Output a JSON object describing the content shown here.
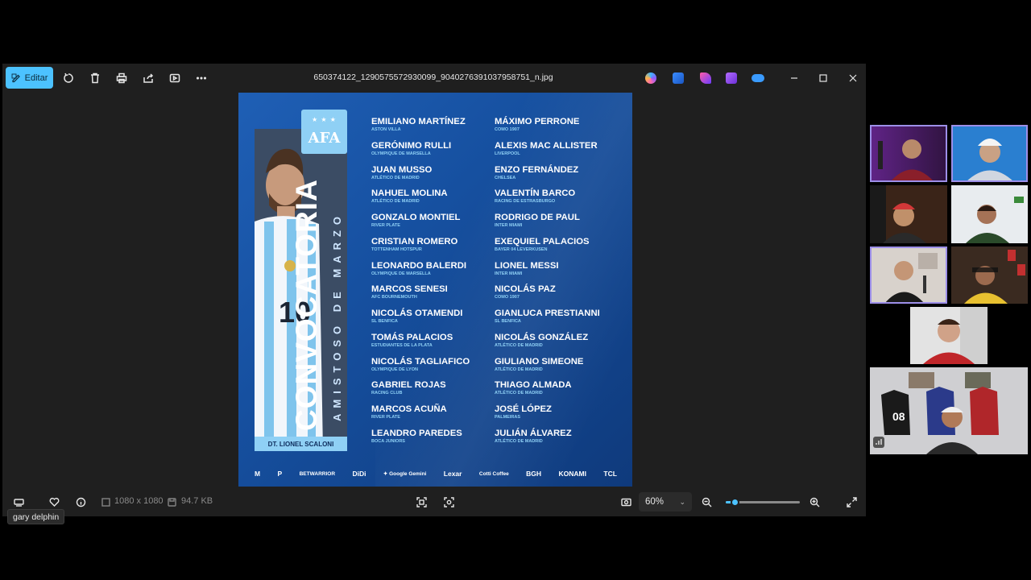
{
  "toolbar": {
    "edit_label": "Editar",
    "icons": [
      "edit-icon",
      "rotate-icon",
      "delete-icon",
      "print-icon",
      "share-icon",
      "slideshow-icon",
      "more-icon"
    ],
    "filename": "650374122_1290575572930099_9040276391037958751_n.jpg"
  },
  "poster": {
    "afa_label": "AFA",
    "afa_stars": "★ ★ ★",
    "title": "CONVOCATORIA",
    "subtitle": "AMISTOSO DE MARZO",
    "coach": "DT. LIONEL SCALONI",
    "players_left": [
      {
        "name": "EMILIANO MARTÍNEZ",
        "club": "ASTON VILLA"
      },
      {
        "name": "GERÓNIMO RULLI",
        "club": "OLYMPIQUE DE MARSELLA"
      },
      {
        "name": "JUAN MUSSO",
        "club": "ATLÉTICO DE MADRID"
      },
      {
        "name": "NAHUEL MOLINA",
        "club": "ATLÉTICO DE MADRID"
      },
      {
        "name": "GONZALO MONTIEL",
        "club": "RIVER PLATE"
      },
      {
        "name": "CRISTIAN ROMERO",
        "club": "TOTTENHAM HOTSPUR"
      },
      {
        "name": "LEONARDO BALERDI",
        "club": "OLYMPIQUE DE MARSELLA"
      },
      {
        "name": "MARCOS SENESI",
        "club": "AFC BOURNEMOUTH"
      },
      {
        "name": "NICOLÁS OTAMENDI",
        "club": "SL BENFICA"
      },
      {
        "name": "TOMÁS PALACIOS",
        "club": "ESTUDIANTES DE LA PLATA"
      },
      {
        "name": "NICOLÁS TAGLIAFICO",
        "club": "OLYMPIQUE DE LYON"
      },
      {
        "name": "GABRIEL ROJAS",
        "club": "RACING CLUB"
      },
      {
        "name": "MARCOS ACUÑA",
        "club": "RIVER PLATE"
      },
      {
        "name": "LEANDRO PAREDES",
        "club": "BOCA JUNIORS"
      }
    ],
    "players_right": [
      {
        "name": "MÁXIMO PERRONE",
        "club": "COMO 1907"
      },
      {
        "name": "ALEXIS MAC ALLISTER",
        "club": "LIVERPOOL"
      },
      {
        "name": "ENZO FERNÁNDEZ",
        "club": "CHELSEA"
      },
      {
        "name": "VALENTÍN BARCO",
        "club": "RACING DE ESTRASBURGO"
      },
      {
        "name": "RODRIGO DE PAUL",
        "club": "INTER MIAMI"
      },
      {
        "name": "EXEQUIEL PALACIOS",
        "club": "BAYER 04 LEVERKUSEN"
      },
      {
        "name": "LIONEL MESSI",
        "club": "INTER MIAMI"
      },
      {
        "name": "NICOLÁS PAZ",
        "club": "COMO 1907"
      },
      {
        "name": "GIANLUCA PRESTIANNI",
        "club": "SL BENFICA"
      },
      {
        "name": "NICOLÁS GONZÁLEZ",
        "club": "ATLÉTICO DE MADRID"
      },
      {
        "name": "GIULIANO SIMEONE",
        "club": "ATLÉTICO DE MADRID"
      },
      {
        "name": "THIAGO ALMADA",
        "club": "ATLÉTICO DE MADRID"
      },
      {
        "name": "JOSÉ LÓPEZ",
        "club": "PALMEIRAS"
      },
      {
        "name": "JULIÁN ÁLVAREZ",
        "club": "ATLÉTICO DE MADRID"
      }
    ],
    "sponsors": [
      "M",
      "P",
      "BETWARRIOR",
      "DiDi",
      "✦ Google Gemini",
      "Lexar",
      "Cotti Coffee",
      "BGH",
      "KONAMI",
      "TCL"
    ]
  },
  "bottombar": {
    "dimensions": "1080 x 1080",
    "filesize": "94.7 KB",
    "zoom": "60%",
    "zoom_level": 0.12
  },
  "tooltip": "gary delphin",
  "colors": {
    "accent": "#4cc2ff",
    "poster_blue": "#1650a0",
    "poster_light_blue": "#8fd0f5",
    "active_tile_border": "#9d8fe8"
  }
}
